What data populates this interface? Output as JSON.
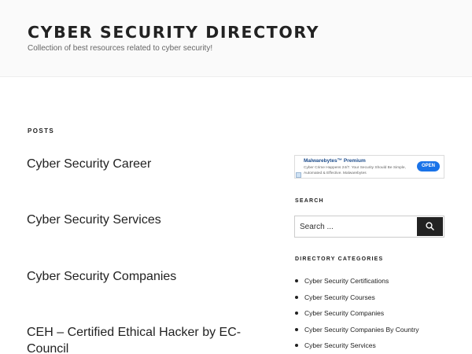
{
  "header": {
    "title": "CYBER SECURITY DIRECTORY",
    "description": "Collection of best resources related to cyber security!"
  },
  "main": {
    "heading": "POSTS",
    "posts": [
      "Cyber Security Career",
      "Cyber Security Services",
      "Cyber Security Companies",
      "CEH – Certified Ethical Hacker by EC-Council"
    ]
  },
  "sidebar": {
    "ad": {
      "title": "Malwarebytes™ Premium",
      "text": "Cyber Crime Happens 24/7. Your Security Should Be Simple, Automated & Effective. Malwarebytes",
      "button": "OPEN"
    },
    "search": {
      "heading": "SEARCH",
      "placeholder": "Search ..."
    },
    "categories": {
      "heading": "DIRECTORY CATEGORIES",
      "items": [
        "Cyber Security Certifications",
        "Cyber Security Courses",
        "Cyber Security Companies",
        "Cyber Security Companies By Country",
        "Cyber Security Services"
      ]
    }
  },
  "colors": {
    "header_bg": "#fafafa",
    "text": "#222222",
    "accent_button": "#1a73e8"
  },
  "icons": {
    "search_button": "search-icon",
    "ad_badge": "ad-choices-icon"
  }
}
